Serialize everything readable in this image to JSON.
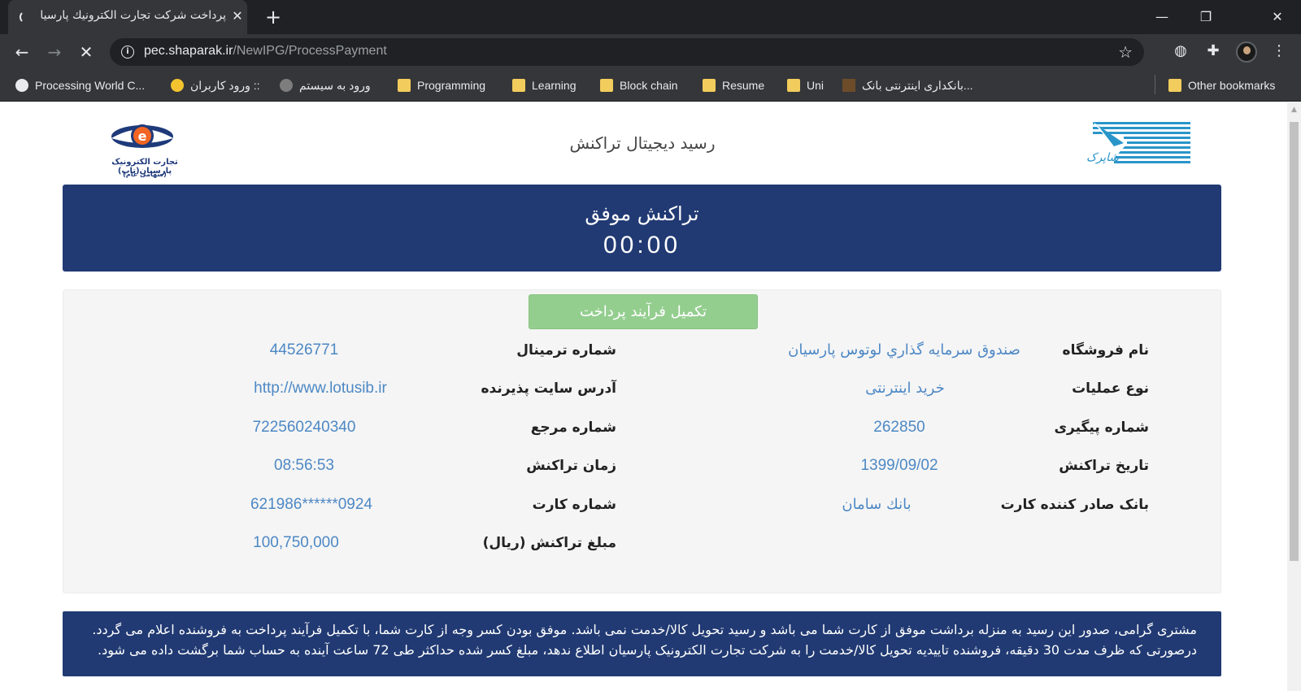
{
  "browser": {
    "tab_title": "پرداخت شرکت تجارت الکترونیك پارسیان",
    "tab_close": "✕",
    "new_tab": "+",
    "window": {
      "minimize": "—",
      "maximize": "❐",
      "close": "✕"
    },
    "nav": {
      "back": "←",
      "forward": "→",
      "stop": "✕"
    },
    "url_host": "pec.shaparak.ir",
    "url_path": "/NewIPG/ProcessPayment",
    "bookmarks": [
      {
        "label": "Processing World C...",
        "icon": "globe-icon"
      },
      {
        "label": "ورود کاربران ::",
        "icon": "smiley-icon"
      },
      {
        "label": "ورود به سیستم",
        "icon": "gear-icon"
      },
      {
        "label": "Programming",
        "icon": "folder-icon"
      },
      {
        "label": "Learning",
        "icon": "folder-icon"
      },
      {
        "label": "Block chain",
        "icon": "folder-icon"
      },
      {
        "label": "Resume",
        "icon": "folder-icon"
      },
      {
        "label": "Uni",
        "icon": "folder-icon"
      },
      {
        "label": "بانکداری اینترنتی بانک...",
        "icon": "bank-icon"
      },
      {
        "label": "Other bookmarks",
        "icon": "folder-icon"
      }
    ]
  },
  "page": {
    "header_title": "رسید دیجیتال تراکنش",
    "tap_logo_line1": "تجارت الکترونیک پارسیان(تاپ)",
    "tap_logo_line2": "(سهامی عام)",
    "shaparak_logo_text": "شاپرک",
    "status_title": "تراکنش موفق",
    "timer": "00:00",
    "complete_button": "تکمیل فرآیند پرداخت",
    "fields": {
      "store_name_label": "نام فروشگاه",
      "store_name_value": "صندوق سرمايه گذاري لوتوس پارسيان",
      "terminal_label": "شماره ترمینال",
      "terminal_value": "44526771",
      "operation_label": "نوع عملیات",
      "operation_value": "خرید اینترنتی",
      "site_label": "آدرس سایت پذیرنده",
      "site_value": "http://www.lotusib.ir",
      "tracking_label": "شماره پیگیری",
      "tracking_value": "262850",
      "reference_label": "شماره مرجع",
      "reference_value": "722560240340",
      "date_label": "تاریخ تراکنش",
      "date_value": "1399/09/02",
      "time_label": "زمان تراکنش",
      "time_value": "08:56:53",
      "issuer_label": "بانک صادر کننده کارت",
      "issuer_value": "بانك سامان",
      "card_label": "شماره کارت",
      "card_value": "621986******0924",
      "amount_label": "مبلغ تراکنش (ریال)",
      "amount_value": "100,750,000"
    },
    "notice_line1": "مشتری گرامی، صدور این رسید به منزله برداشت موفق از کارت شما می باشد و رسید تحویل کالا/خدمت نمی باشد. موفق بودن کسر وجه از کارت شما، با تکمیل فرآیند پرداخت به فروشنده اعلام می گردد.",
    "notice_line2": "درصورتی که ظرف مدت 30 دقیقه، فروشنده تاییدیه تحویل کالا/خدمت را به شرکت تجارت الکترونیک پارسیان اطلاع ندهد، مبلغ کسر شده حداکثر طی 72 ساعت آینده به حساب شما برگشت داده می شود."
  },
  "colors": {
    "banner": "#213a73",
    "value_text": "#4d88c4",
    "complete_button": "#94ce8f"
  }
}
